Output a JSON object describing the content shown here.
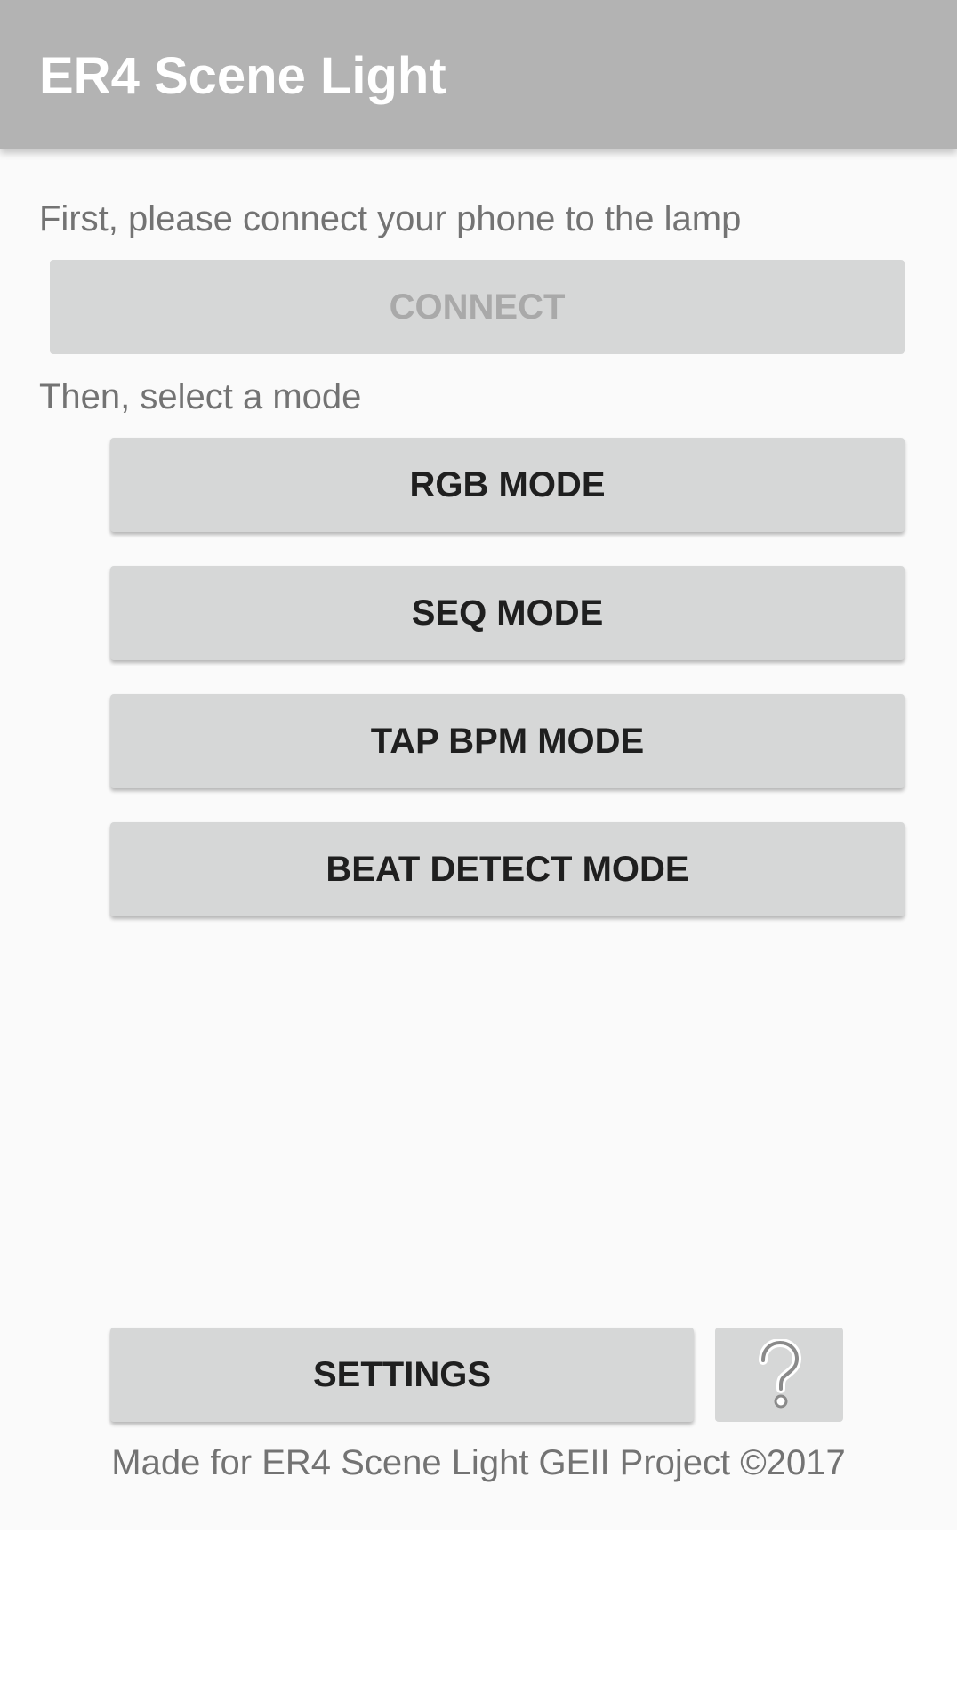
{
  "app": {
    "title": "ER4 Scene Light"
  },
  "main": {
    "connect_prompt": "First, please connect your phone to the lamp",
    "connect_button": "CONNECT",
    "mode_prompt": "Then, select a mode",
    "modes": [
      {
        "label": "RGB MODE"
      },
      {
        "label": "SEQ MODE"
      },
      {
        "label": "TAP BPM MODE"
      },
      {
        "label": "BEAT DETECT MODE"
      }
    ]
  },
  "bottom": {
    "settings_button": "SETTINGS",
    "help_icon": "question-mark-icon",
    "footer_text": "Made for ER4 Scene Light GEII Project ©2017"
  },
  "colors": {
    "appbar": "#b3b3b3",
    "background": "#fafafa",
    "button": "#d6d7d7",
    "button_text": "#1f1f1f",
    "disabled_text": "#a9a9a9",
    "secondary_text": "#737373"
  }
}
